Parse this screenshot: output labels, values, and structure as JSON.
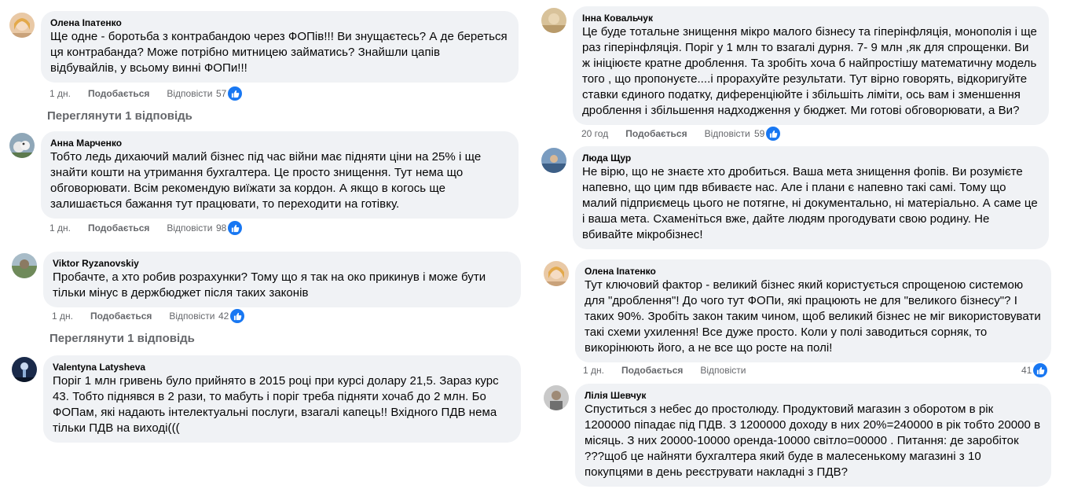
{
  "actions": {
    "like": "Подобається",
    "reply": "Відповісти"
  },
  "left_column": [
    {
      "author": "Олена Іпатенко",
      "text": "Ще одне - боротьба з контрабандою через ФОПів!!! Ви знущаєтесь? А де береться ця контрабанда? Може потрібно митницею займатись? Знайшли цапів відбувайлів, у всьому винні ФОПи!!!",
      "time": "1 дн.",
      "reactions": "57",
      "view_replies": "Переглянути 1 відповідь"
    },
    {
      "author": "Анна Марченко",
      "text": "Тобто ледь дихаючий малий бізнес під час війни має підняти ціни на 25% і ще знайти кошти на утримання бухгалтера. Це просто знищення. Тут нема що обговорювати. Всім рекомендую виїжати за кордон. А якщо в когось ще залишається бажання тут працювати, то переходити на готівку.",
      "time": "1 дн.",
      "reactions": "98"
    },
    {
      "author": "Viktor Ryzanovskiy",
      "text": "Пробачте, а хто робив розрахунки? Тому що я так на око прикинув і може бути тільки мінус в держбюджет після таких законів",
      "time": "1 дн.",
      "reactions": "42",
      "view_replies": "Переглянути 1 відповідь"
    },
    {
      "author": "Valentyna Latysheva",
      "text": "Поріг 1 млн гривень було прийнято в 2015 році при курсі долару 21,5. Зараз курс 43. Тобто піднявся в 2 рази, то мабуть і поріг треба підняти хочаб до 2 млн. Бо ФОПам, які надають інтелектуальні послуги, взагалі капець!! Вхідного ПДВ нема тільки ПДВ на виході((("
    }
  ],
  "right_column": [
    {
      "author": "Інна Ковальчук",
      "text": "Це буде тотальне знищення мікро малого бізнесу та гіперінфляція, монополія і ще раз гіперінфляція. Поріг у 1 млн то взагалі дурня. 7- 9 млн ,як для спрощенки. Ви ж ініціюєте кратне дроблення. Та зробіть хоча б найпростішу математичну модель того , що пропонуєте....і прорахуйте результати. Тут вірно говорять, відкоригуйте ставки єдиного податку, диференціюйте і збільшіть ліміти, ось вам і зменшення дроблення і збільшення надходження у бюджет. Ми готові обговорювати, а Ви?",
      "time": "20 год",
      "reactions": "59"
    },
    {
      "author": "Люда Щур",
      "text": "Не вірю, що не знаєте хто дробиться. Ваша мета знищення фопів. Ви розумієте напевно, що цим пдв вбиваєте нас. Але і плани є напевно такі самі. Тому що малий підприємець цього не потягне, ні документально, ні матеріально. А саме це і ваша мета. Схаменіться вже, дайте людям прогодувати свою родину. Не вбивайте мікробізнес!"
    },
    {
      "author": "Олена Іпатенко",
      "text": "Тут ключовий фактор - великий бізнес який користується спрощеною системою для \"дроблення\"! До чого тут ФОПи, які працюють не для \"великого бізнесу\"? І таких 90%. Зробіть закон таким чином, щоб великий бізнес не міг використовувати такі схеми ухилення! Все дуже просто. Коли у полі заводиться сорняк, то викорінюють його, а не все що росте на полі!",
      "time": "1 дн.",
      "reactions": "41"
    },
    {
      "author": "Лілія Шевчук",
      "text": "Спуститься з небес до простолюду. Продуктовий магазин з оборотом в рік 1200000 піпадає під ПДВ. З 1200000 доходу в них 20%=240000 в рік тобто 20000 в місяць. З них 20000-10000 оренда-10000 світло=00000 . Питання: де заробіток ???щоб це найняти бухгалтера який буде в малесенькому магазині з 10 покупцями в день реєструвати накладні з ПДВ?"
    }
  ],
  "colors": {
    "bubble": "#f0f2f5",
    "meta": "#65676b",
    "like_blue": "#1877f2"
  }
}
